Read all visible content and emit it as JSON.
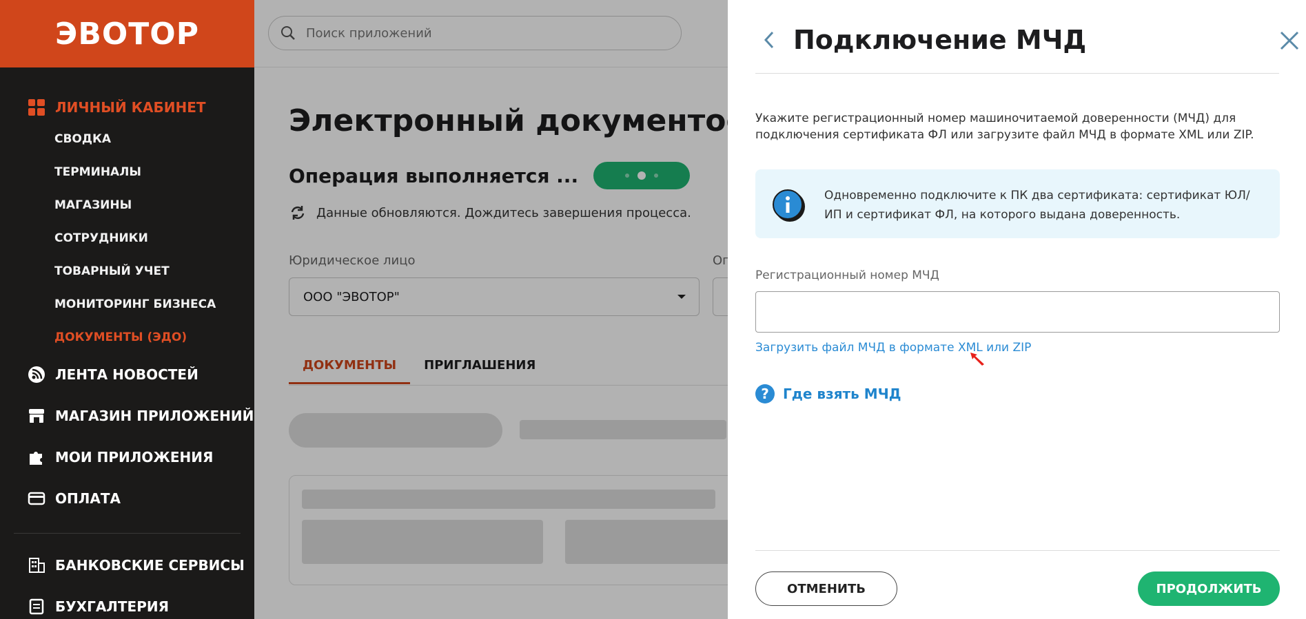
{
  "sidebar": {
    "logo": "ЭВОТОР",
    "cabinet": "ЛИЧНЫЙ КАБИНЕТ",
    "subitems": [
      "СВОДКА",
      "ТЕРМИНАЛЫ",
      "МАГАЗИНЫ",
      "СОТРУДНИКИ",
      "ТОВАРНЫЙ УЧЕТ",
      "МОНИТОРИНГ БИЗНЕСА",
      "ДОКУМЕНТЫ (ЭДО)"
    ],
    "items": [
      "ЛЕНТА НОВОСТЕЙ",
      "МАГАЗИН ПРИЛОЖЕНИЙ",
      "МОИ ПРИЛОЖЕНИЯ",
      "ОПЛАТА",
      "БАНКОВСКИЕ СЕРВИСЫ",
      "БУХГАЛТЕРИЯ"
    ]
  },
  "search": {
    "placeholder": "Поиск приложений"
  },
  "main": {
    "title": "Электронный документообо",
    "operation": "Операция выполняется ...",
    "refresh_text": "Данные обновляются. Дождитесь завершения процесса.",
    "legal_entity_label": "Юридическое лицо",
    "legal_entity_value": "ООО \"ЭВОТОР\"",
    "second_label": "Оп",
    "tabs": [
      "ДОКУМЕНТЫ",
      "ПРИГЛАШЕНИЯ"
    ]
  },
  "drawer": {
    "title": "Подключение МЧД",
    "description": "Укажите регистрационный номер машиночитаемой доверенности (МЧД) для подключения сертификата ФЛ или загрузите файл МЧД в формате XML или ZIP.",
    "info": "Одновременно подключите к ПК два сертификата: сертификат ЮЛ/ИП и сертификат ФЛ, на которого выдана доверенность.",
    "input_label": "Регистрационный номер МЧД",
    "input_value": "",
    "upload_link": "Загрузить файл МЧД в формате XML или ZIP",
    "where_link": "Где взять МЧД",
    "cancel": "ОТМЕНИТЬ",
    "continue": "ПРОДОЛЖИТЬ"
  },
  "colors": {
    "brand": "#d0461b",
    "accent_green": "#1fb471",
    "link": "#2a8bd4",
    "info_bg": "#e8f6fc"
  }
}
